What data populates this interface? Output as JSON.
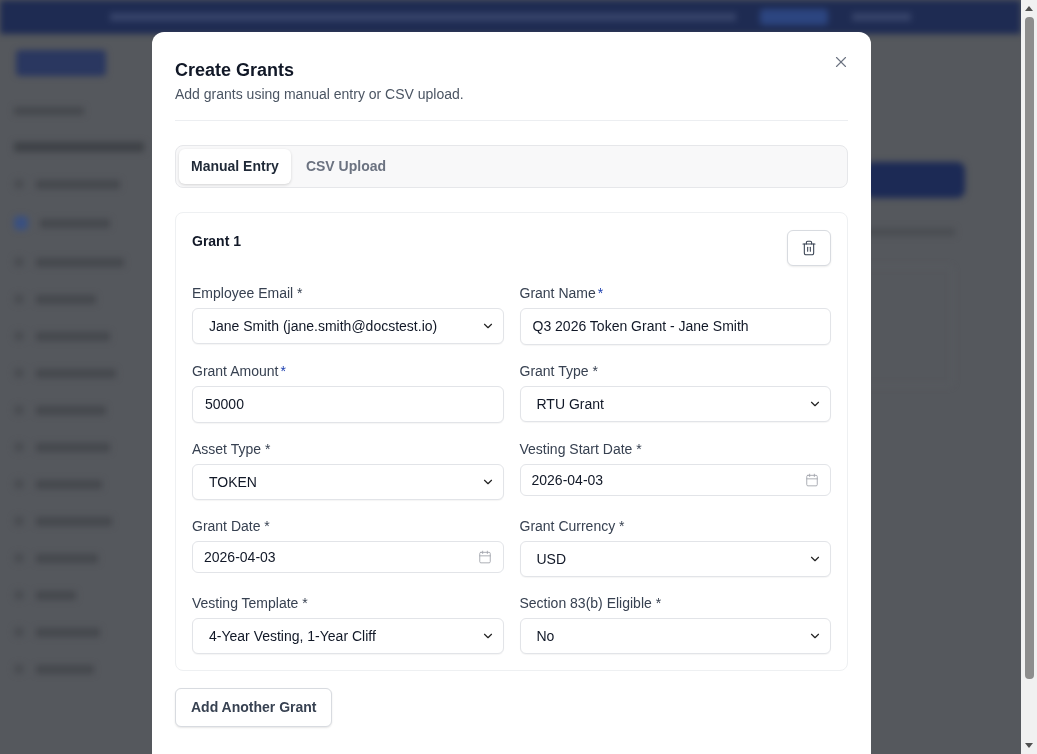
{
  "dialog": {
    "title": "Create Grants",
    "subtitle": "Add grants using manual entry or CSV upload."
  },
  "tabs": [
    {
      "label": "Manual Entry",
      "selected": true
    },
    {
      "label": "CSV Upload",
      "selected": false
    }
  ],
  "grants": [
    {
      "title": "Grant 1",
      "fields": [
        {
          "label": "Employee Email *",
          "kind": "select",
          "value": "Jane Smith (jane.smith@docstest.io)"
        },
        {
          "label": "Grant Name",
          "required_mark": "*",
          "kind": "text",
          "value": "Q3 2026 Token Grant - Jane Smith"
        },
        {
          "label": "Grant Amount",
          "required_mark": "*",
          "kind": "text",
          "value": "50000"
        },
        {
          "label": "Grant Type *",
          "kind": "select",
          "value": "RTU Grant"
        },
        {
          "label": "Asset Type *",
          "kind": "select",
          "value": "TOKEN"
        },
        {
          "label": "Vesting Start Date *",
          "kind": "date",
          "value": "2026-04-03"
        },
        {
          "label": "Grant Date *",
          "kind": "date",
          "value": "2026-04-03"
        },
        {
          "label": "Grant Currency *",
          "kind": "select",
          "value": "USD"
        },
        {
          "label": "Vesting Template *",
          "kind": "select",
          "value": "4-Year Vesting, 1-Year Cliff"
        },
        {
          "label": "Section 83(b) Eligible *",
          "kind": "select",
          "value": "No"
        }
      ]
    }
  ],
  "add_button": {
    "label": "Add Another Grant"
  }
}
